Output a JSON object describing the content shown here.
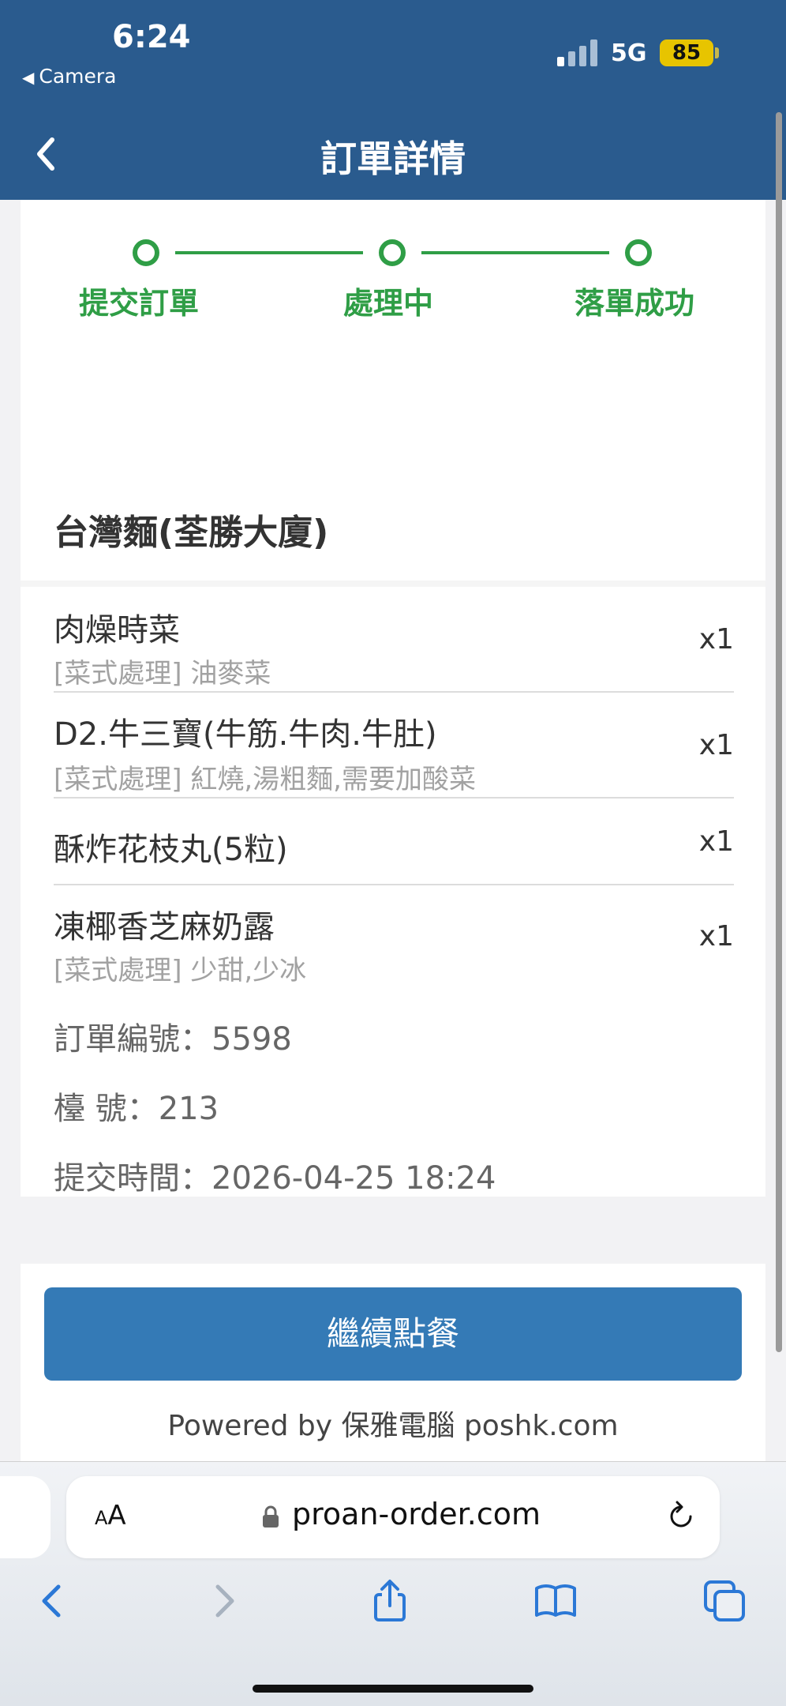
{
  "status_bar": {
    "time": "6:24",
    "back_app": "Camera",
    "network": "5G",
    "battery": "85"
  },
  "header": {
    "title": "訂單詳情"
  },
  "progress": {
    "steps": [
      {
        "label": "提交訂單"
      },
      {
        "label": "處理中"
      },
      {
        "label": "落單成功"
      }
    ],
    "color": "#2f9e46"
  },
  "store": {
    "name": "台灣麵(荃勝大廈)"
  },
  "items": [
    {
      "name": "肉燥時菜",
      "options": "[菜式處理] 油麥菜",
      "qty": "x1"
    },
    {
      "name": "D2.牛三寶(牛筋.牛肉.牛肚)",
      "options": "[菜式處理] 紅燒,湯粗麵,需要加酸菜",
      "qty": "x1"
    },
    {
      "name": "酥炸花枝丸(5粒)",
      "options": "",
      "qty": "x1"
    },
    {
      "name": "凍椰香芝麻奶露",
      "options": "[菜式處理] 少甜,少冰",
      "qty": "x1"
    }
  ],
  "order_meta": {
    "order_no": "訂單編號：5598",
    "table_no": "檯 號：213",
    "submit_time": "提交時間：2026-04-25 18:24"
  },
  "actions": {
    "continue_label": "繼續點餐"
  },
  "footer": {
    "powered_by": "Powered by 保雅電腦 poshk.com"
  },
  "browser": {
    "aa_label": "AA",
    "url": "proan-order.com"
  },
  "colors": {
    "header_bg": "#2a5b8e",
    "button_bg": "#347ab6",
    "battery": "#e7c400"
  }
}
